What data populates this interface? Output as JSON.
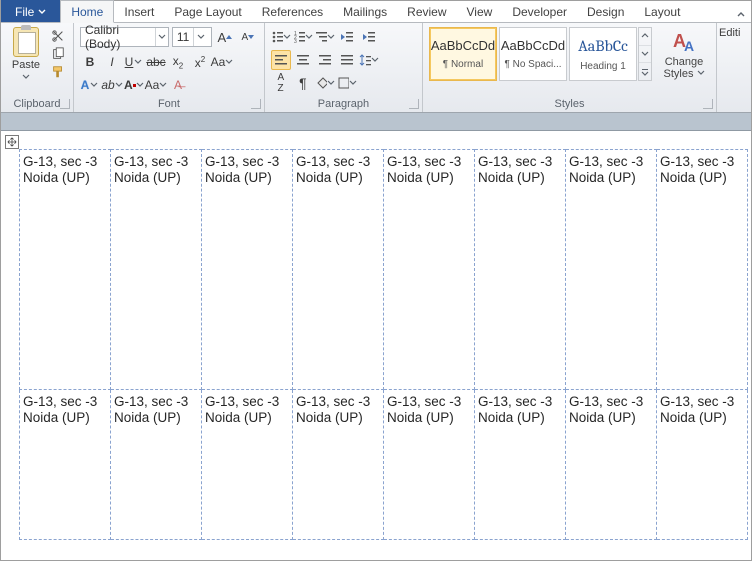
{
  "menu": {
    "file": "File",
    "tabs": [
      "Home",
      "Insert",
      "Page Layout",
      "References",
      "Mailings",
      "Review",
      "View",
      "Developer",
      "Design",
      "Layout"
    ],
    "active": "Home"
  },
  "ribbon": {
    "clipboard": {
      "paste": "Paste",
      "label": "Clipboard"
    },
    "font": {
      "name": "Calibri (Body)",
      "size": "11",
      "label": "Font"
    },
    "paragraph": {
      "label": "Paragraph"
    },
    "styles": {
      "tiles": [
        {
          "sample": "AaBbCcDd",
          "name": "¶ Normal"
        },
        {
          "sample": "AaBbCcDd",
          "name": "¶ No Spaci..."
        },
        {
          "sample": "AaBbCc",
          "name": "Heading 1"
        }
      ],
      "change": "Change Styles",
      "label": "Styles"
    },
    "editing": {
      "label": "Editi"
    }
  },
  "document": {
    "cell": {
      "line1": "G-13, sec -3",
      "line2": "Noida (UP)"
    },
    "cols": 8,
    "rows": 2
  }
}
